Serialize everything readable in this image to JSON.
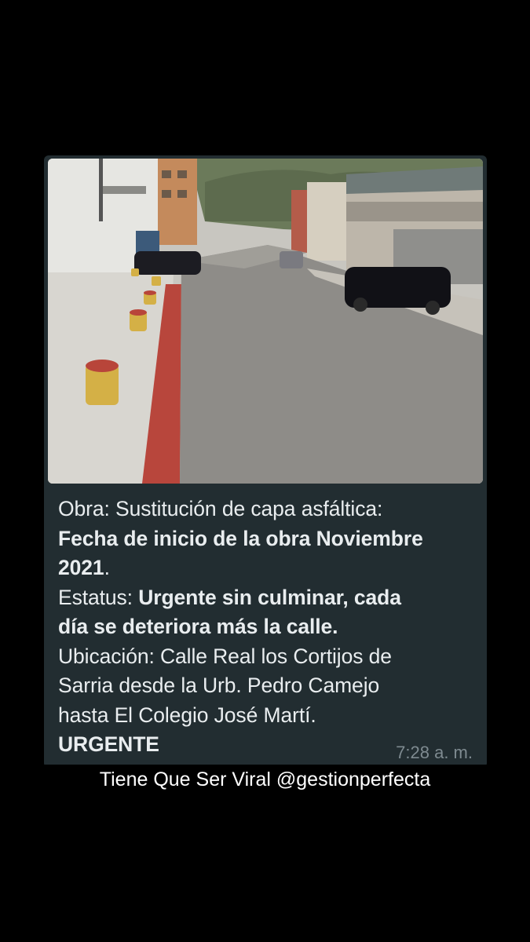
{
  "message": {
    "photo": {
      "description_icon": "street-photo-image"
    },
    "line_obra_label": "Obra: Sustitución de capa asfáltica:",
    "line_fecha": "Fecha de inicio de la obra Noviembre",
    "line_year_bold": "2021",
    "line_year_end": ".",
    "line_estatus_label": "Estatus: ",
    "line_estatus_bold_1": "Urgente sin culminar, cada",
    "line_estatus_bold_2": "día se deteriora más la calle.",
    "line_ubicacion_1": "Ubicación: Calle Real los Cortijos de",
    "line_ubicacion_2": "Sarria desde la Urb. Pedro Camejo",
    "line_ubicacion_3": "hasta  El Colegio José Martí.",
    "urgent_label": "URGENTE",
    "timestamp": "7:28 a. m."
  },
  "caption": "Tiene Que Ser Viral @gestionperfecta",
  "colors": {
    "background": "#000000",
    "bubble": "#222d31",
    "text": "#e9edef",
    "timestamp": "#7e8a90"
  }
}
